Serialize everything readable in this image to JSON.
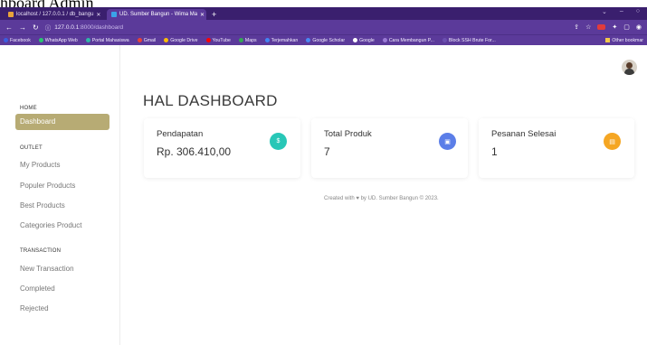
{
  "caption": "hboard Admin",
  "browser": {
    "tabs": [
      {
        "label": "localhost / 127.0.0.1 / db_bangu",
        "active": false,
        "color": "#e8a33a"
      },
      {
        "label": "UD. Sumber Bangun - Wima Ma",
        "active": true,
        "color": "#3aa3e8"
      }
    ],
    "new_tab": "+",
    "window_controls": [
      "⌄",
      "–",
      "○"
    ],
    "address": {
      "host": "127.0.0.1",
      "path": ":8000/dashboard"
    },
    "bookmarks": [
      {
        "label": "Facebook",
        "color": "#3b5de0"
      },
      {
        "label": "WhatsApp Web",
        "color": "#28c76f"
      },
      {
        "label": "Portal Mahasiswa",
        "color": "#2fb8a8"
      },
      {
        "label": "Gmail",
        "color": "#ea4335"
      },
      {
        "label": "Google Drive",
        "color": "#fbbc05"
      },
      {
        "label": "YouTube",
        "color": "#ff0000"
      },
      {
        "label": "Maps",
        "color": "#34a853"
      },
      {
        "label": "Terjemahkan",
        "color": "#4285f4"
      },
      {
        "label": "Google Scholar",
        "color": "#4a8af4"
      },
      {
        "label": "Google",
        "color": "#ffffff"
      },
      {
        "label": "Cara Membangun P...",
        "color": "#9b7bd6"
      },
      {
        "label": "Block SSH Brute For...",
        "color": "#6b4fb0"
      }
    ],
    "other_bookmarks": "Other bookmar"
  },
  "sidebar": {
    "home_heading": "HOME",
    "dashboard": "Dashboard",
    "outlet_heading": "OUTLET",
    "outlet_items": [
      "My Products",
      "Populer Products",
      "Best Products",
      "Categories Product"
    ],
    "transaction_heading": "TRANSACTION",
    "transaction_items": [
      "New Transaction",
      "Completed",
      "Rejected"
    ]
  },
  "main": {
    "title": "HAL DASHBOARD",
    "cards": [
      {
        "label": "Pendapatan",
        "value": "Rp. 306.410,00",
        "icon": "dollar-icon",
        "glyph": "$",
        "color": "#28c7b7"
      },
      {
        "label": "Total Produk",
        "value": "7",
        "icon": "box-icon",
        "glyph": "▣",
        "color": "#5b7ee8"
      },
      {
        "label": "Pesanan Selesai",
        "value": "1",
        "icon": "receipt-icon",
        "glyph": "▤",
        "color": "#f5a623"
      }
    ],
    "footer": "Created with ♥ by UD. Sumber Bangun © 2023."
  }
}
